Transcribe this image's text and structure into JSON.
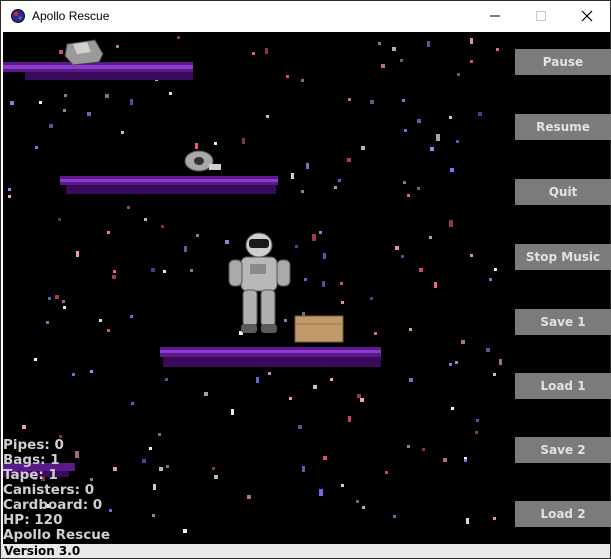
{
  "window": {
    "title": "Apollo Rescue",
    "controls": {
      "minimize": "—",
      "maximize": "☐",
      "close": "✕"
    }
  },
  "hud": {
    "pipes": "Pipes: 0",
    "bags": "Bags: 1",
    "tape": "Tape: 1",
    "canisters": "Canisters: 0",
    "cardboard": "Cardboard: 0",
    "hp": "HP: 120",
    "game_name": "Apollo Rescue"
  },
  "buttons": {
    "pause": "Pause",
    "resume": "Resume",
    "quit": "Quit",
    "stop_music": "Stop Music",
    "save1": "Save 1",
    "load1": "Load 1",
    "save2": "Save 2",
    "load2": "Load 2"
  },
  "status": {
    "version": "Version 3.0"
  },
  "colors": {
    "background": "#000000",
    "platform": "#8a2be2",
    "button": "#7b7b7b",
    "button_text": "#e2e2e2",
    "hud_text": "#cfcfcf",
    "star_pink": "#ff5f8f",
    "star_blue": "#7a7aff"
  },
  "icons": [
    "app-planet-icon",
    "minimize-icon",
    "maximize-icon",
    "close-icon"
  ]
}
